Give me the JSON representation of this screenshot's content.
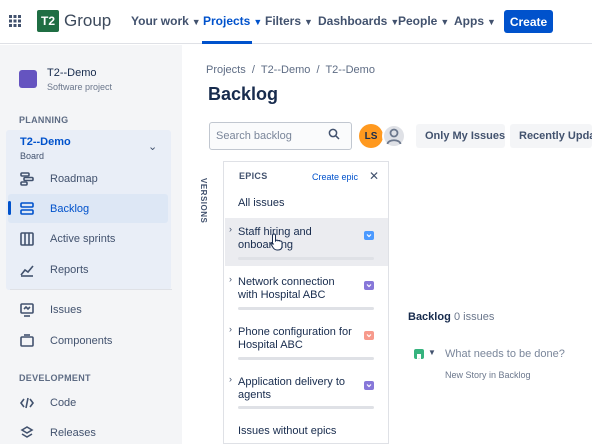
{
  "topbar": {
    "logo_mark": "T2",
    "logo_text": "Group",
    "nav": [
      {
        "label": "Your work"
      },
      {
        "label": "Projects"
      },
      {
        "label": "Filters"
      },
      {
        "label": "Dashboards"
      },
      {
        "label": "People"
      },
      {
        "label": "Apps"
      }
    ],
    "create_label": "Create"
  },
  "sidebar": {
    "project_name": "T2--Demo",
    "project_type": "Software project",
    "planning_label": "PLANNING",
    "board_name": "T2--Demo",
    "board_sub": "Board",
    "planning_items": [
      {
        "label": "Roadmap",
        "icon": "roadmap-icon"
      },
      {
        "label": "Backlog",
        "icon": "backlog-icon"
      },
      {
        "label": "Active sprints",
        "icon": "active-sprints-icon"
      },
      {
        "label": "Reports",
        "icon": "reports-icon"
      }
    ],
    "other_items": [
      {
        "label": "Issues",
        "icon": "issues-icon"
      },
      {
        "label": "Components",
        "icon": "components-icon"
      }
    ],
    "development_label": "DEVELOPMENT",
    "dev_items": [
      {
        "label": "Code",
        "icon": "code-icon"
      },
      {
        "label": "Releases",
        "icon": "releases-icon"
      }
    ]
  },
  "main": {
    "breadcrumb": [
      "Projects",
      "T2--Demo",
      "T2--Demo"
    ],
    "title": "Backlog",
    "search_placeholder": "Search backlog",
    "avatar_initials": "LS",
    "filters": [
      "Only My Issues",
      "Recently Updated"
    ],
    "versions_label": "VERSIONS",
    "epics": {
      "title": "EPICS",
      "create_label": "Create epic",
      "all_issues": "All issues",
      "items": [
        {
          "name": "Staff hiring and onboarding",
          "color": "#4c9aff"
        },
        {
          "name": "Network connection with Hospital ABC",
          "color": "#8777d9"
        },
        {
          "name": "Phone configuration for Hospital ABC",
          "color": "#f79a8c"
        },
        {
          "name": "Application delivery to agents",
          "color": "#8777d9"
        }
      ],
      "no_epics": "Issues without epics"
    },
    "backlog": {
      "label": "Backlog",
      "count": "0 issues",
      "new_issue_placeholder": "What needs to be done?",
      "new_issue_hint": "New Story in Backlog"
    }
  }
}
